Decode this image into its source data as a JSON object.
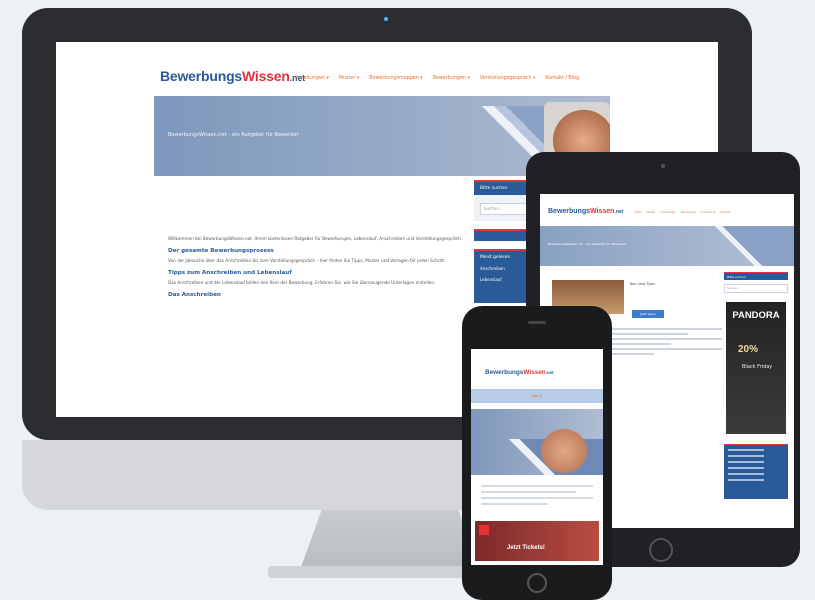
{
  "desktop": {
    "logo": {
      "part1": "Bewerbungs",
      "part2": "Wissen",
      "part3": ".net"
    },
    "nav": [
      "Anleitungen ▾",
      "Muster ▾",
      "Bewerbungsmappen ▾",
      "Bewerbungen ▾",
      "Vorstellungsgespräch ▾",
      "Kontakt / Blog"
    ],
    "hero_text": "BewerbungsWissen.net – ein Ratgeber für Bewerber",
    "content": {
      "intro": "Willkommen bei BewerbungsWissen.net, Ihrem kostenlosen Ratgeber für Bewerbungen, Lebenslauf, Anschreiben und Vorstellungsgespräch.",
      "h1": "Der gesamte Bewerbungsprozess",
      "p1": "Von der Jobsuche über das Anschreiben bis zum Vorstellungsgespräch – hier finden Sie Tipps, Muster und Vorlagen für jeden Schritt.",
      "h2": "Tipps zum Anschreiben und Lebenslauf",
      "p2": "Das Anschreiben und der Lebenslauf bilden den Kern der Bewerbung. Erfahren Sie, wie Sie überzeugende Unterlagen erstellen.",
      "h3": "Das Anschreiben"
    },
    "sidebar": {
      "search_head": "Bitte suchen",
      "search_placeholder": "Suchen...",
      "links_head": "Meist gelesen",
      "link1": "Anschreiben",
      "link2": "Lebenslauf"
    }
  },
  "tablet": {
    "logo": {
      "part1": "Bewerbungs",
      "part2": "Wissen",
      "part3": ".net"
    },
    "nav": [
      "Start",
      "Muster",
      "Anleitungen",
      "Bewerbung",
      "Vorstellung",
      "Kontakt"
    ],
    "hero_text": "BewerbungsWissen.net – ein Ratgeber für Bewerber",
    "book_title": "Neu: Jetzt Tipps",
    "book_button": "Jetzt lesen",
    "side_head": "Bitte suchen",
    "search_placeholder": "Suchen",
    "ad": {
      "brand": "PANDORA",
      "percent": "20%",
      "text": "Black Friday"
    }
  },
  "phone": {
    "logo": {
      "part1": "Bewerbungs",
      "part2": "Wissen",
      "part3": ".net"
    },
    "menu": "Menü",
    "news_text": "Jetzt Tickets!"
  }
}
